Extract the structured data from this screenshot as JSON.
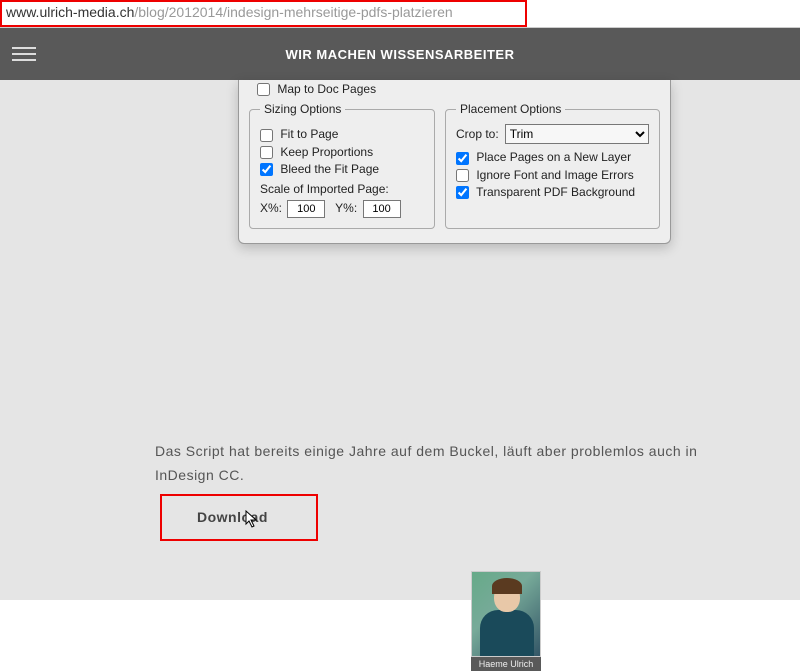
{
  "url": {
    "host": "www.ulrich-media.ch",
    "path": "/blog/2012014/indesign-mehrseitige-pdfs-platzieren"
  },
  "nav": {
    "title": "WIR MACHEN WISSENSARBEITER"
  },
  "dialog": {
    "map_to_doc": "Map to Doc Pages",
    "sizing_legend": "Sizing Options",
    "fit_to_page": "Fit to Page",
    "keep_proportions": "Keep Proportions",
    "bleed_fit": "Bleed the Fit Page",
    "scale_label": "Scale of Imported Page:",
    "x_label": "X%:",
    "x_value": "100",
    "y_label": "Y%:",
    "y_value": "100",
    "placement_legend": "Placement Options",
    "crop_label": "Crop to:",
    "crop_value": "Trim",
    "new_layer": "Place Pages on a New Layer",
    "ignore_errors": "Ignore Font and Image Errors",
    "transparent_bg": "Transparent PDF Background"
  },
  "article": {
    "body": "Das Script hat bereits einige Jahre auf dem Buckel, läuft aber problemlos auch in InDesign CC.",
    "download": "Download"
  },
  "author": {
    "name": "Haeme Ulrich"
  }
}
